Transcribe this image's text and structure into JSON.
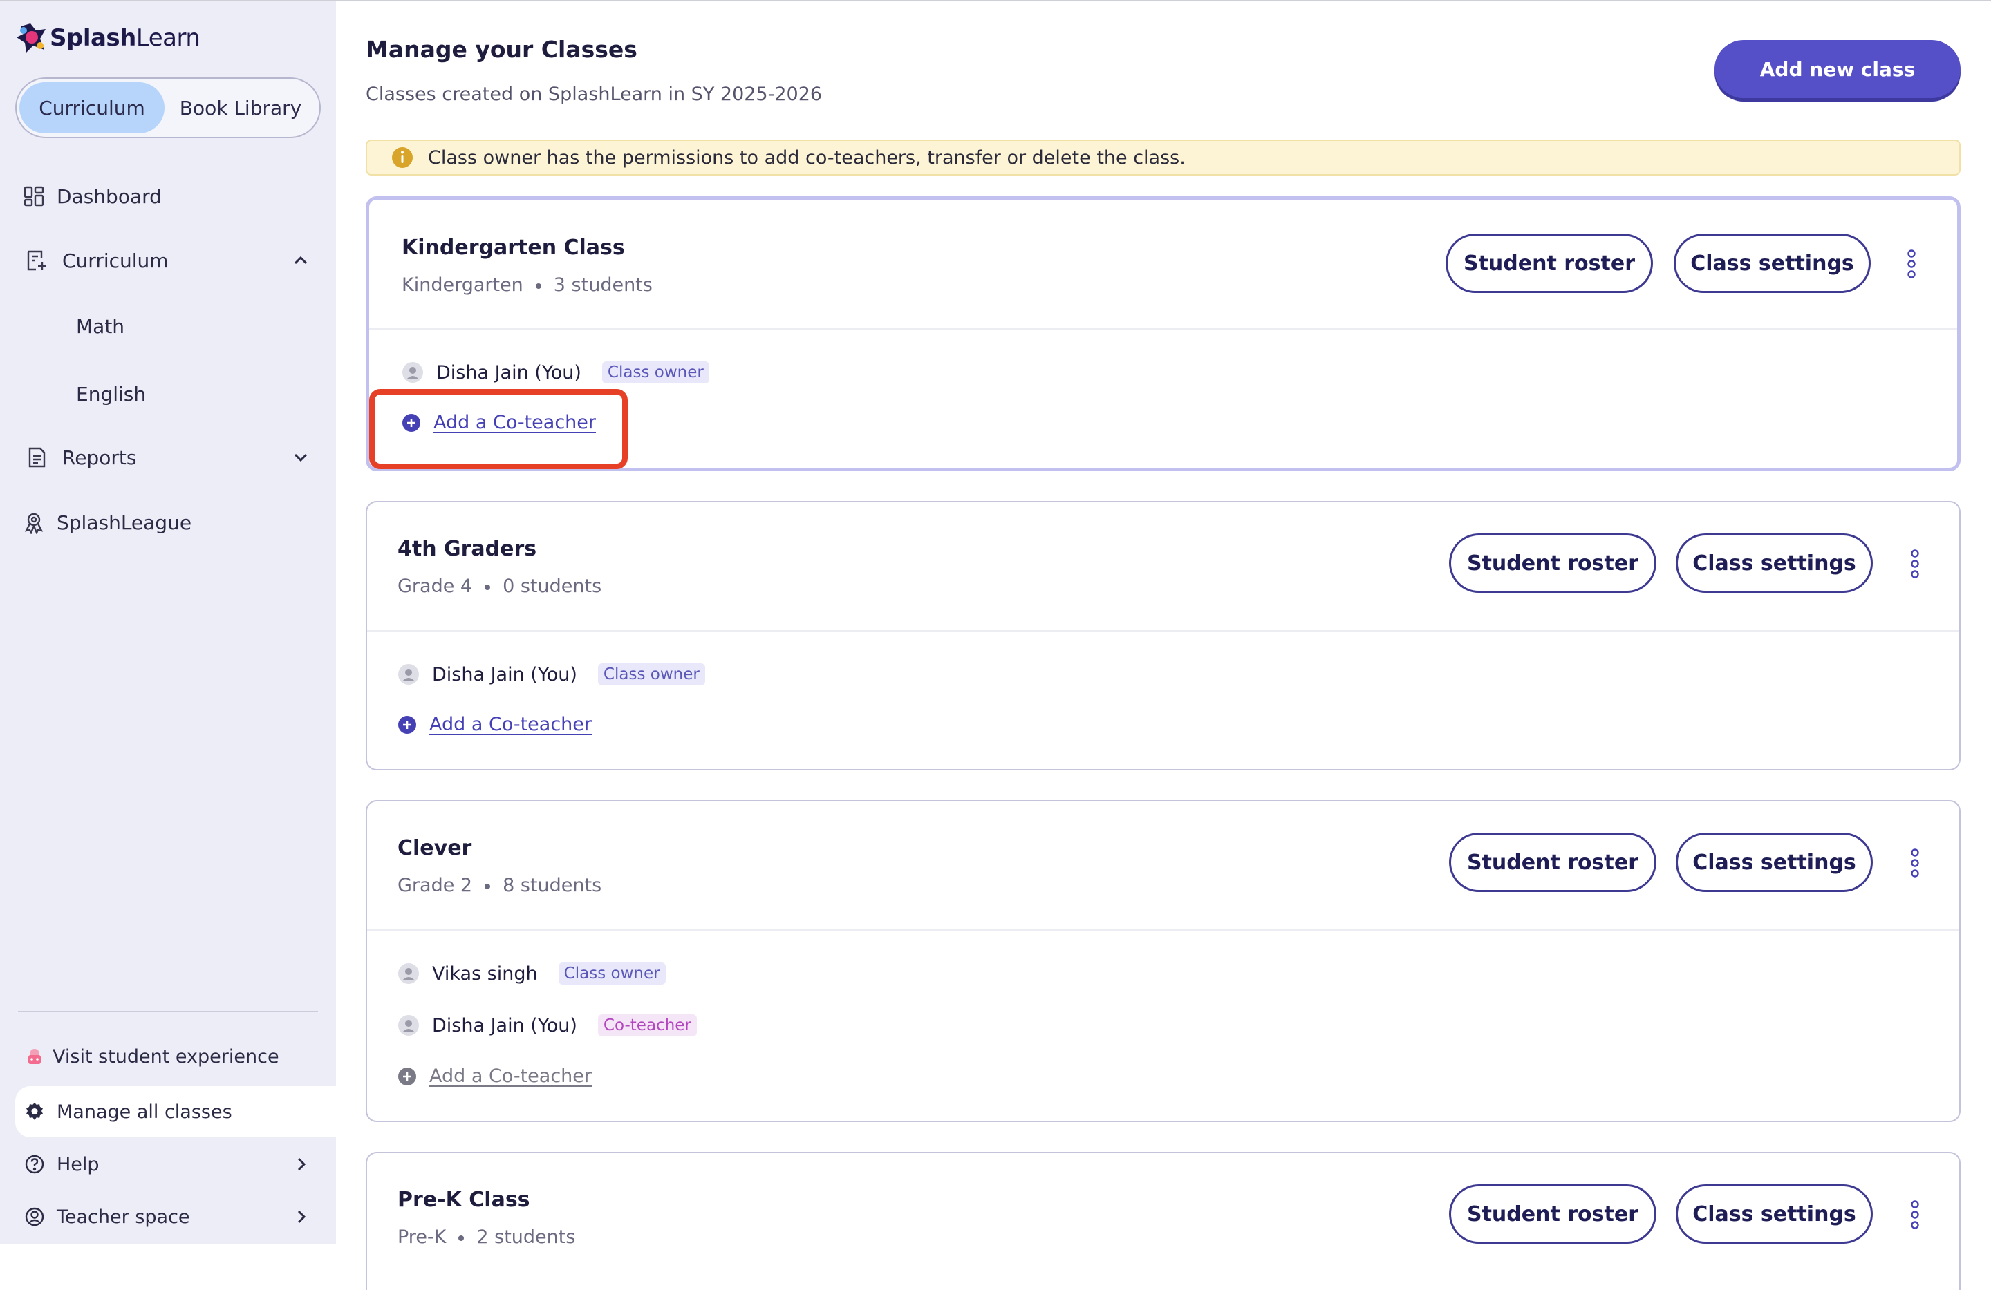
{
  "logo": {
    "brand_bold": "Splash",
    "brand_light": "Learn"
  },
  "segment": {
    "active": "Curriculum",
    "inactive": "Book Library"
  },
  "nav": {
    "dashboard": "Dashboard",
    "curriculum": "Curriculum",
    "math": "Math",
    "english": "English",
    "reports": "Reports",
    "splashleague": "SplashLeague"
  },
  "bottom_nav": {
    "visit": "Visit student experience",
    "manage": "Manage all classes",
    "help": "Help",
    "teacher_space": "Teacher space"
  },
  "main": {
    "title": "Manage your Classes",
    "subtitle": "Classes created on SplashLearn in SY 2025-2026",
    "add_class": "Add new class",
    "notice": "Class owner has the permissions to add co-teachers, transfer or delete the class."
  },
  "buttons": {
    "roster": "Student roster",
    "settings": "Class settings"
  },
  "add_coteacher": "Add a Co-teacher",
  "classes": [
    {
      "name": "Kindergarten Class",
      "grade": "Kindergarten",
      "students": "3 students",
      "teachers": [
        {
          "name": "Disha Jain (You)",
          "role": "Class owner"
        }
      ]
    },
    {
      "name": "4th Graders",
      "grade": "Grade 4",
      "students": "0 students",
      "teachers": [
        {
          "name": "Disha Jain (You)",
          "role": "Class owner"
        }
      ]
    },
    {
      "name": "Clever",
      "grade": "Grade 2",
      "students": "8 students",
      "teachers": [
        {
          "name": "Vikas singh",
          "role": "Class owner"
        },
        {
          "name": "Disha Jain (You)",
          "role": "Co-teacher"
        }
      ]
    },
    {
      "name": "Pre-K Class",
      "grade": "Pre-K",
      "students": "2 students",
      "teachers": []
    }
  ],
  "colors": {
    "sidebar_bg": "#ededf7",
    "primary": "#5550c8",
    "highlight": "#e64127",
    "notice_bg": "#fdf4d6"
  },
  "icons": [
    "dashboard-icon",
    "curriculum-icon",
    "reports-icon",
    "splashleague-icon",
    "student-experience-icon",
    "gear-icon",
    "help-icon",
    "teacher-space-icon",
    "info-icon",
    "user-avatar-icon",
    "plus-circle-icon",
    "kebab-menu-icon",
    "chevron-up-icon",
    "chevron-down-icon",
    "chevron-right-icon"
  ]
}
